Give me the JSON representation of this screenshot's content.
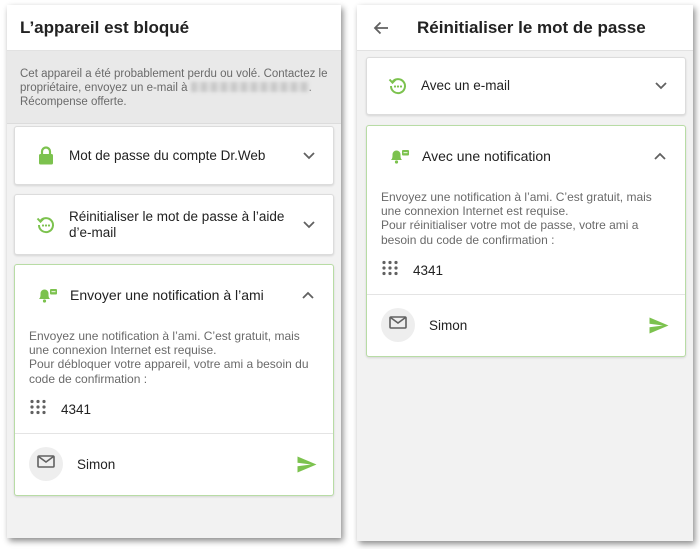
{
  "left": {
    "title": "L’appareil est bloqué",
    "banner": {
      "text_before": "Cet appareil a été probablement perdu ou volé. Contactez le propriétaire, envoyez un e-mail à ",
      "text_after": ". Récompense offerte."
    },
    "options": [
      {
        "label": "Mot de passe du compte Dr.Web",
        "icon": "lock-icon"
      },
      {
        "label": "Réinitialiser le mot de passe à l’aide d’e-mail",
        "icon": "reset-icon"
      }
    ],
    "notification": {
      "label": "Envoyer une notification à l’ami",
      "icon": "notification-bell-icon",
      "description_lines": [
        "Envoyez une notification à l’ami. C’est gratuit, mais",
        "une connexion Internet est requise.",
        "Pour débloquer votre appareil, votre ami a besoin du",
        "code de confirmation :"
      ],
      "code": "4341",
      "contact": "Simon"
    }
  },
  "right": {
    "title": "Réinitialiser le mot de passe",
    "email_option": {
      "label": "Avec un e-mail",
      "icon": "reset-icon"
    },
    "notification": {
      "label": "Avec une notification",
      "icon": "notification-bell-icon",
      "description_lines": [
        "Envoyez une notification à l’ami. C’est gratuit, mais",
        "une connexion Internet est requise.",
        "Pour réinitialiser votre mot de passe, votre ami a",
        "besoin du code de confirmation :"
      ],
      "code": "4341",
      "contact": "Simon"
    }
  },
  "colors": {
    "accent_green": "#7cc24e",
    "border_active": "#b8dca5",
    "icon_gray": "#616161"
  }
}
